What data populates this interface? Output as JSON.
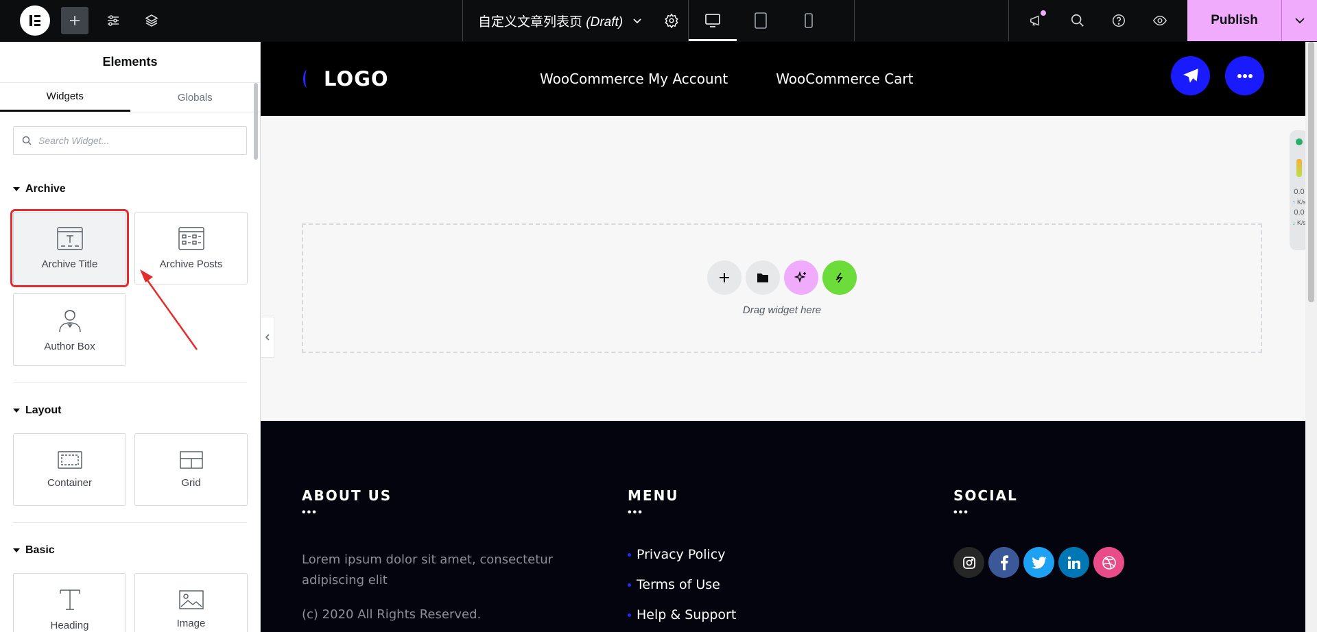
{
  "topbar": {
    "doc_title": "自定义文章列表页",
    "doc_status": "(Draft)",
    "publish_label": "Publish"
  },
  "panel": {
    "title": "Elements",
    "tabs": [
      "Widgets",
      "Globals"
    ],
    "search_placeholder": "Search Widget...",
    "categories": {
      "archive": {
        "label": "Archive",
        "widgets": [
          "Archive Title",
          "Archive Posts",
          "Author Box"
        ]
      },
      "layout": {
        "label": "Layout",
        "widgets": [
          "Container",
          "Grid"
        ]
      },
      "basic": {
        "label": "Basic",
        "widgets": [
          "Heading",
          "Image"
        ]
      }
    }
  },
  "site": {
    "logo_text": "LOGO",
    "nav": [
      "WooCommerce My Account",
      "WooCommerce Cart"
    ],
    "drop_text": "Drag widget here",
    "footer": {
      "about_title": "ABOUT US",
      "about_text": "Lorem ipsum dolor sit amet, consectetur adipiscing elit",
      "copyright": "(c) 2020 All Rights Reserved.",
      "menu_title": "MENU",
      "menu_items": [
        "Privacy Policy",
        "Terms of Use",
        "Help & Support"
      ],
      "social_title": "SOCIAL",
      "dots": "•••"
    }
  },
  "speed_widget": {
    "up": "0.0",
    "down": "0.0",
    "unit": "K/s"
  },
  "colors": {
    "accent": "#f0abfc",
    "highlight": "#e52b2b",
    "site_blue": "#1a1aff",
    "footer_bg": "#04040f"
  }
}
